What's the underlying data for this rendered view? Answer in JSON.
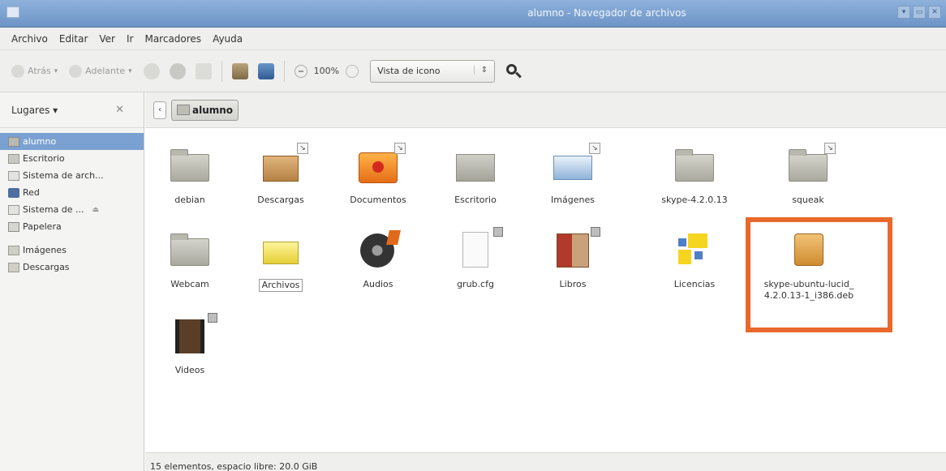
{
  "window": {
    "title": "alumno - Navegador de archivos",
    "buttons": [
      "▾",
      "▭",
      "✕"
    ]
  },
  "menu": [
    "Archivo",
    "Editar",
    "Ver",
    "Ir",
    "Marcadores",
    "Ayuda"
  ],
  "toolbar": {
    "back_label": "Atrás",
    "forward_label": "Adelante",
    "zoom_level": "100%",
    "view_select": "Vista de icono",
    "select_arrows": "⇕"
  },
  "sidebar": {
    "header": "Lugares ▾",
    "close": "✕",
    "places": [
      "alumno",
      "Escritorio",
      "Sistema de arch...",
      "Red",
      "Sistema de ...",
      "Papelera"
    ],
    "bookmarks": [
      "Imágenes",
      "Descargas"
    ],
    "eject": "⏏"
  },
  "pathbar": {
    "back": "‹",
    "crumb": "alumno"
  },
  "files": [
    {
      "label": "debian"
    },
    {
      "label": "Descargas"
    },
    {
      "label": "Documentos"
    },
    {
      "label": "Escritorio"
    },
    {
      "label": "Imágenes"
    },
    {
      "label": "skype-4.2.0.13"
    },
    {
      "label": "squeak"
    },
    {
      "label": "Webcam"
    },
    {
      "label": "Archivos"
    },
    {
      "label": "Audios"
    },
    {
      "label": "grub.cfg"
    },
    {
      "label": "Libros"
    },
    {
      "label": "Licencias"
    },
    {
      "label": "skype-ubuntu-lucid_ 4.2.0.13-1_i386.deb"
    },
    {
      "label": "Videos"
    }
  ],
  "link_badge": "↘",
  "status": "15 elementos, espacio libre: 20.0 GiB",
  "colors": {
    "highlight": "#e8692b",
    "selection": "#7aa1d2",
    "titlebar": "#7fa3d3"
  }
}
